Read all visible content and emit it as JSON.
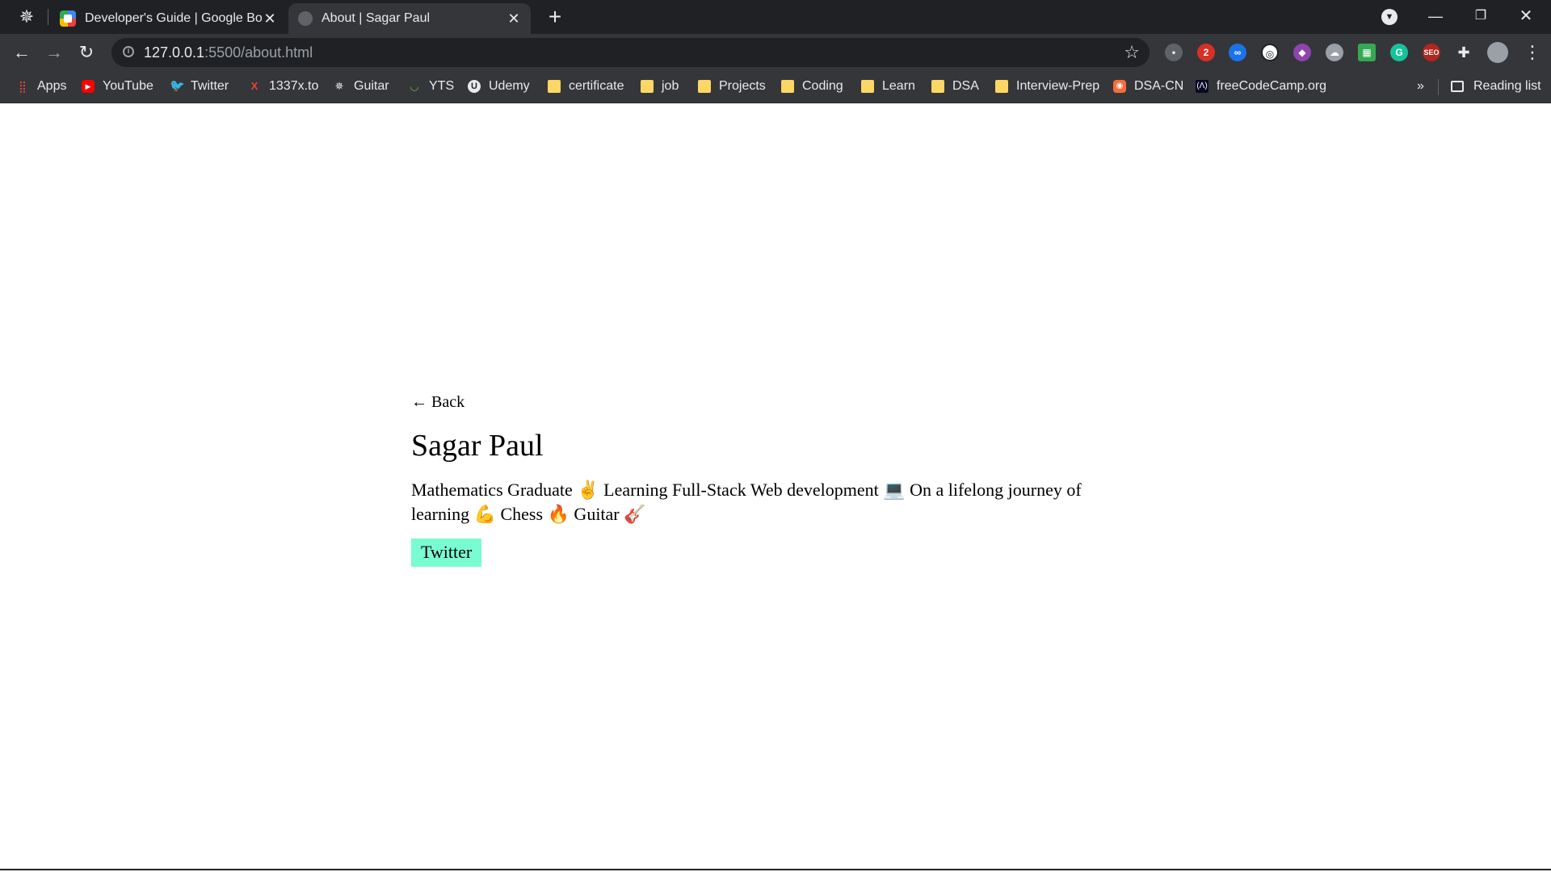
{
  "browser": {
    "tabs": [
      {
        "title": "Developer's Guide  |  Google Boo",
        "active": false
      },
      {
        "title": "About | Sagar Paul",
        "active": true
      }
    ],
    "new_tab_symbol": "+",
    "address": {
      "host": "127.0.0.1",
      "path": ":5500/about.html"
    },
    "window_controls": {
      "minimize": "—",
      "maximize": "❐",
      "close": "✕"
    }
  },
  "bookmarks": {
    "items": [
      {
        "label": "Apps",
        "icon": "apps-grid-icon"
      },
      {
        "label": "YouTube",
        "icon": "youtube-icon"
      },
      {
        "label": "Twitter",
        "icon": "twitter-icon"
      },
      {
        "label": "1337x.to",
        "icon": "1337x-icon"
      },
      {
        "label": "Guitar",
        "icon": "guitar-site-icon"
      },
      {
        "label": "YTS",
        "icon": "yts-icon"
      },
      {
        "label": "Udemy",
        "icon": "udemy-icon"
      },
      {
        "label": "certificate",
        "icon": "folder-icon"
      },
      {
        "label": "job",
        "icon": "folder-icon"
      },
      {
        "label": "Projects",
        "icon": "folder-icon"
      },
      {
        "label": "Coding",
        "icon": "folder-icon"
      },
      {
        "label": "Learn",
        "icon": "folder-icon"
      },
      {
        "label": "DSA",
        "icon": "folder-icon"
      },
      {
        "label": "Interview-Prep",
        "icon": "folder-icon"
      },
      {
        "label": "DSA-CN",
        "icon": "codingninjas-icon"
      },
      {
        "label": "freeCodeCamp.org",
        "icon": "freecodecamp-icon"
      }
    ],
    "overflow": "»",
    "reading_list": "Reading list"
  },
  "page": {
    "back_link": "← Back",
    "name": "Sagar Paul",
    "bio": "Mathematics Graduate ✌️ Learning Full-Stack Web development 💻 On a lifelong journey of learning 💪 Chess 🔥 Guitar 🎸",
    "twitter_button": "Twitter"
  },
  "colors": {
    "tab_strip": "#202124",
    "toolbar": "#35363a",
    "twitter_button_bg": "#79fcd1"
  }
}
